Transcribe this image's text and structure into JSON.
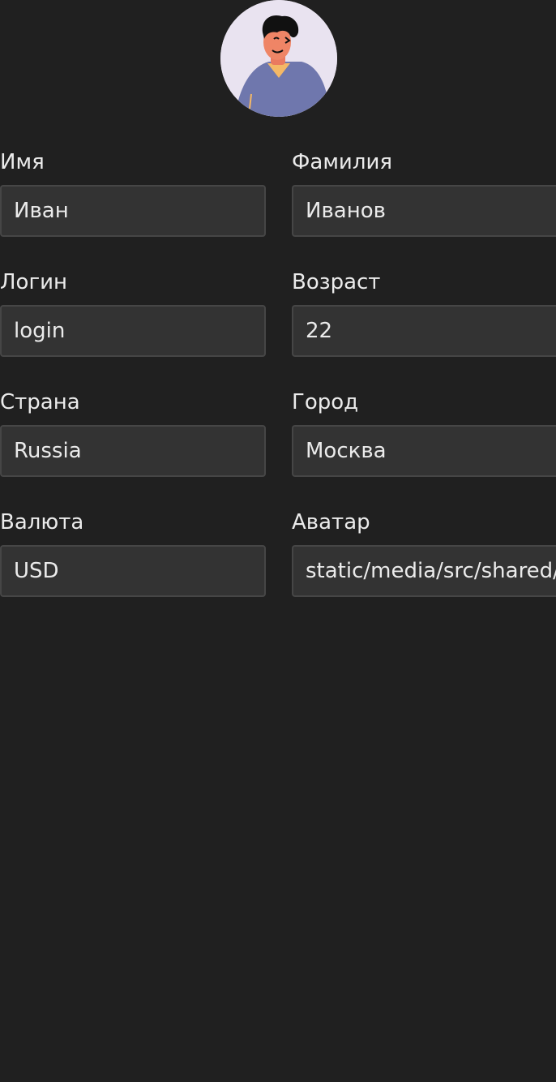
{
  "profile": {
    "avatar_icon": "user-avatar-illustration",
    "fields": {
      "first_name": {
        "label": "Имя",
        "value": "Иван"
      },
      "last_name": {
        "label": "Фамилия",
        "value": "Иванов"
      },
      "login": {
        "label": "Логин",
        "value": "login"
      },
      "age": {
        "label": "Возраст",
        "value": "22"
      },
      "country": {
        "label": "Страна",
        "value": "Russia"
      },
      "city": {
        "label": "Город",
        "value": "Москва"
      },
      "currency": {
        "label": "Валюта",
        "value": "USD"
      },
      "avatar": {
        "label": "Аватар",
        "value": "static/media/src/shared/assets/tests/storybook.jpg"
      }
    }
  },
  "colors": {
    "background": "#202020",
    "input_background": "#333333",
    "input_border": "#464646",
    "text": "#ebebeb"
  }
}
